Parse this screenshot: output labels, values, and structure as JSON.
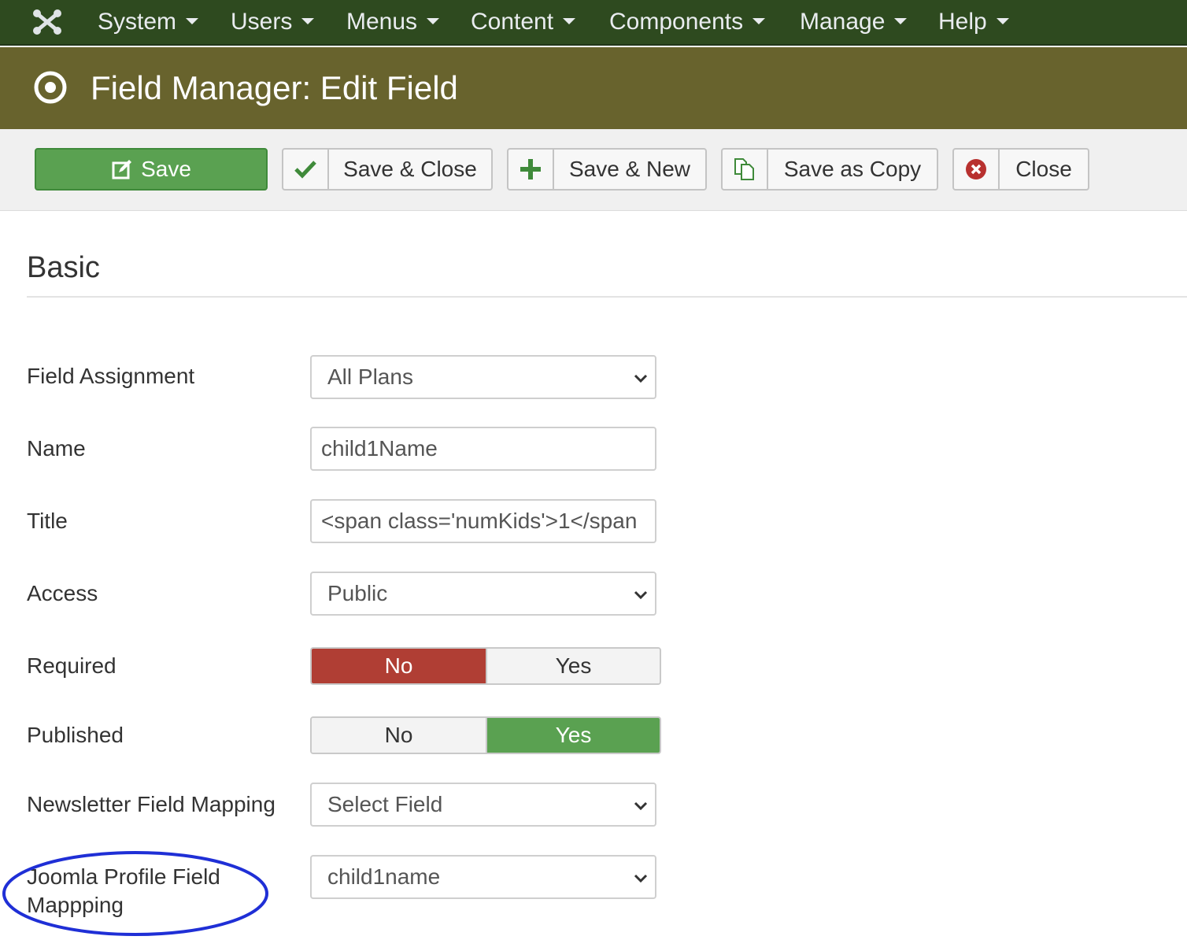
{
  "nav": {
    "logo_icon": "joomla-logo-icon",
    "items": [
      {
        "label": "System"
      },
      {
        "label": "Users"
      },
      {
        "label": "Menus"
      },
      {
        "label": "Content"
      },
      {
        "label": "Components"
      },
      {
        "label": "Manage"
      },
      {
        "label": "Help"
      }
    ]
  },
  "header": {
    "icon": "target-icon",
    "title": "Field Manager: Edit Field"
  },
  "toolbar": {
    "save": {
      "label": "Save",
      "icon": "edit-icon"
    },
    "save_close": {
      "label": "Save & Close",
      "icon": "checkmark-icon"
    },
    "save_new": {
      "label": "Save & New",
      "icon": "plus-icon"
    },
    "save_copy": {
      "label": "Save as Copy",
      "icon": "copy-icon"
    },
    "close": {
      "label": "Close",
      "icon": "close-circle-icon"
    }
  },
  "section": {
    "title": "Basic"
  },
  "form": {
    "field_assignment": {
      "label": "Field Assignment",
      "value": "All Plans"
    },
    "name": {
      "label": "Name",
      "value": "child1Name"
    },
    "title": {
      "label": "Title",
      "value": "<span class='numKids'>1</span"
    },
    "access": {
      "label": "Access",
      "value": "Public"
    },
    "required": {
      "label": "Required",
      "no": "No",
      "yes": "Yes",
      "selected": "No"
    },
    "published": {
      "label": "Published",
      "no": "No",
      "yes": "Yes",
      "selected": "Yes"
    },
    "newsletter_mapping": {
      "label": "Newsletter Field Mapping",
      "value": "Select Field"
    },
    "joomla_mapping": {
      "label_line1": "Joomla Profile Field",
      "label_line2": "Mappping",
      "value": "child1name"
    }
  },
  "colors": {
    "navbar": "#2e4a1f",
    "titlebar": "#68632d",
    "primary_green": "#5aa151",
    "danger_red": "#b03e34",
    "annotation_blue": "#1f2fd6"
  }
}
